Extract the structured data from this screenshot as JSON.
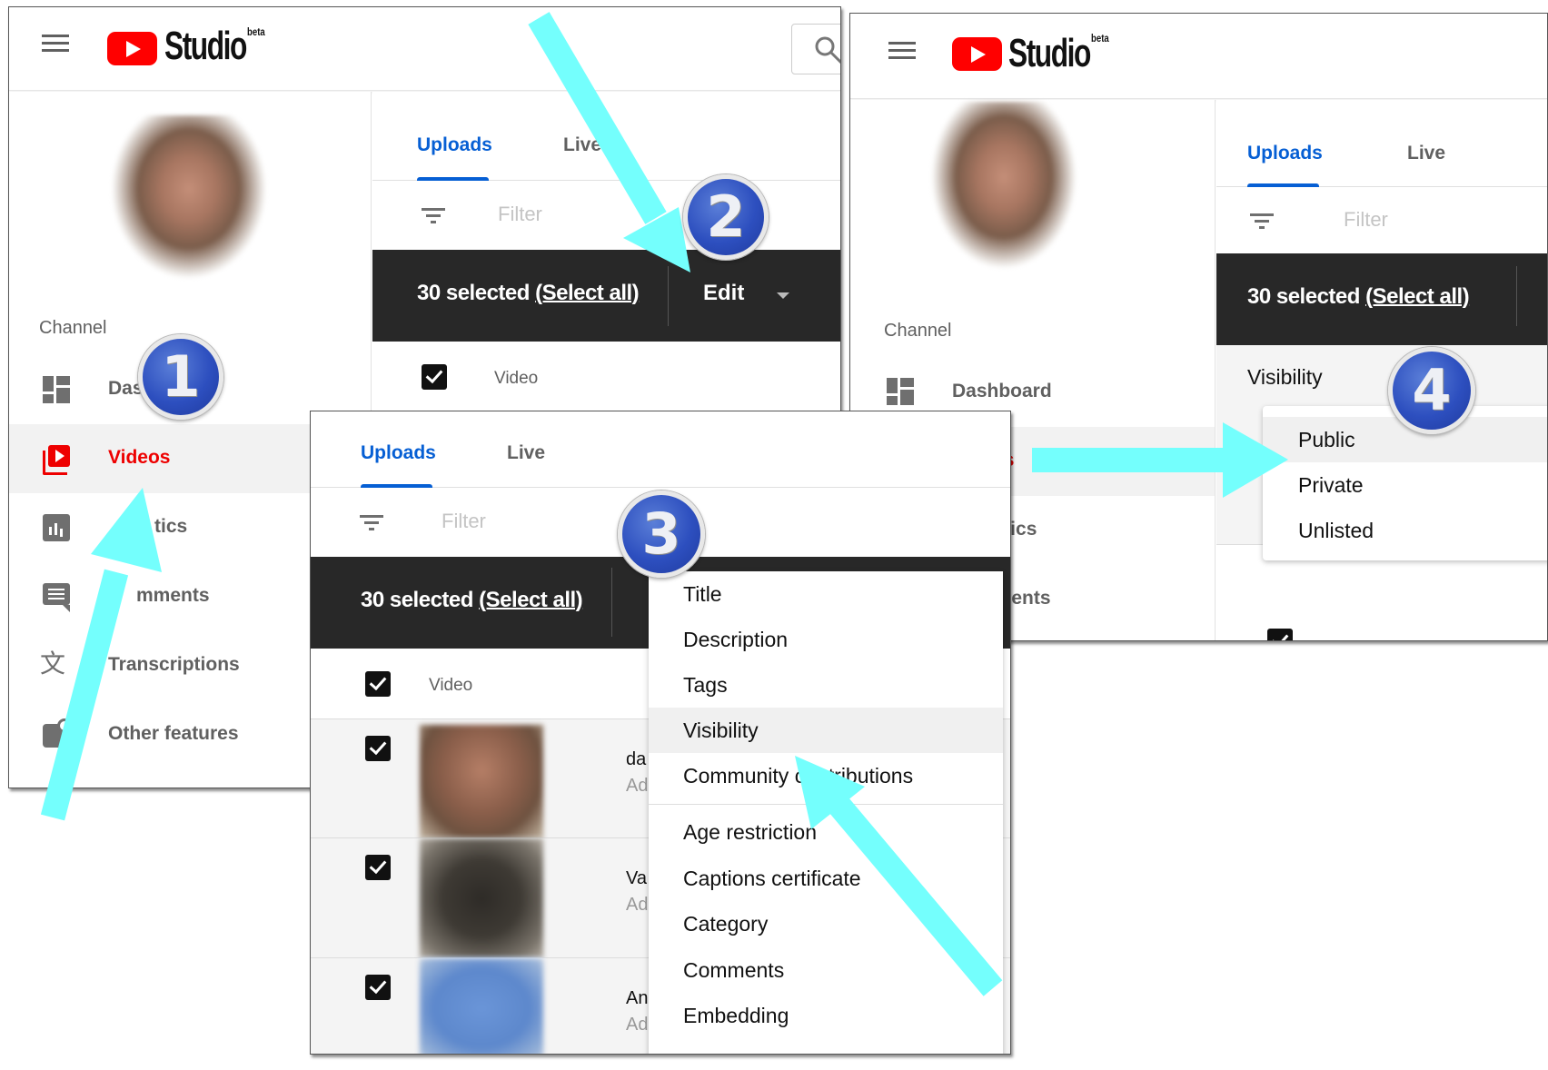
{
  "app": {
    "brand": "Studio",
    "brand_suffix": "beta",
    "accent_color": "#ff0000",
    "active_color": "#e00000",
    "tab_color": "#065fd4",
    "annotation_color": "#74fffd"
  },
  "sidebar": {
    "section_label": "Channel",
    "items": [
      {
        "label": "Dashboard",
        "icon": "dashboard-icon"
      },
      {
        "label": "Videos",
        "icon": "videos-icon",
        "active": true
      },
      {
        "label": "Analytics",
        "icon": "analytics-icon"
      },
      {
        "label": "Comments",
        "icon": "comments-icon"
      },
      {
        "label": "Transcriptions",
        "icon": "transcriptions-icon"
      },
      {
        "label": "Other features",
        "icon": "other-features-icon"
      }
    ],
    "panel1_partial_labels": [
      "Das",
      "Videos",
      "tics",
      "mments",
      "Transcriptions",
      "Other features"
    ]
  },
  "content": {
    "tabs": [
      {
        "label": "Uploads",
        "active": true
      },
      {
        "label": "Live"
      }
    ],
    "filter_placeholder": "Filter",
    "selection": {
      "count_text": "30 selected",
      "select_all": "(Select all)"
    },
    "edit_label": "Edit",
    "column_header": "Video",
    "rows": [
      {
        "title_partial": "da",
        "sub_partial": "Ad"
      },
      {
        "title_partial": "Va",
        "sub_partial": "Ad"
      },
      {
        "title_partial": "An",
        "sub_partial": "Ad"
      }
    ]
  },
  "edit_menu": {
    "items": [
      "Title",
      "Description",
      "Tags",
      "Visibility",
      "Community contributions",
      "Age restriction",
      "Captions certificate",
      "Category",
      "Comments",
      "Embedding"
    ],
    "visible_community_left": "Community c",
    "visible_community_right": "butions",
    "highlighted": "Visibility"
  },
  "visibility": {
    "label": "Visibility",
    "options": [
      "Public",
      "Private",
      "Unlisted"
    ],
    "highlighted": "Public"
  },
  "steps": [
    "1",
    "2",
    "3",
    "4"
  ]
}
